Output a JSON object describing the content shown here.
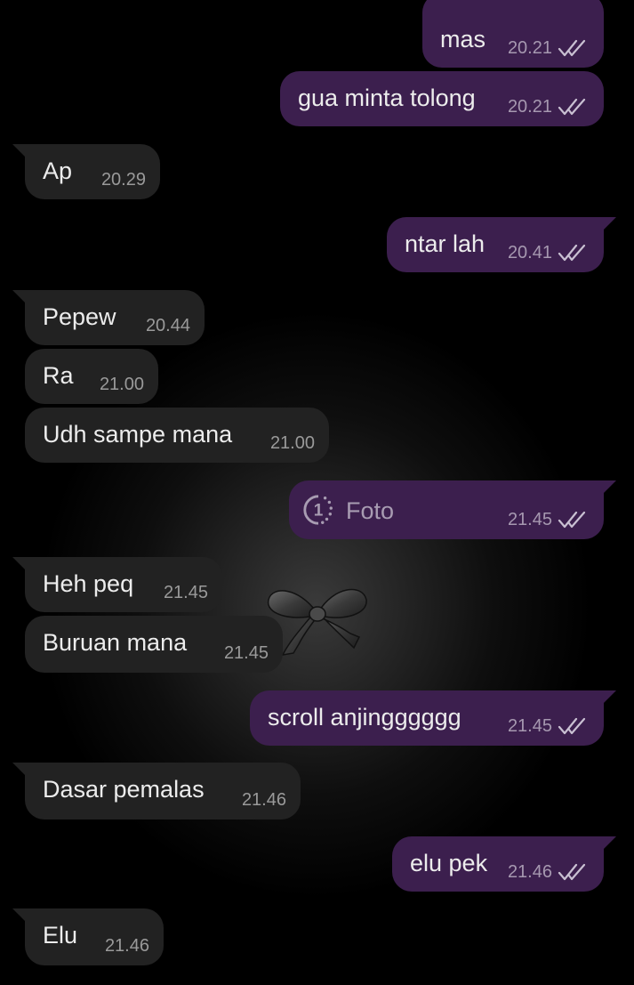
{
  "chat": {
    "messages": [
      {
        "dir": "out",
        "text": "mas",
        "time": "20.21",
        "status": "read"
      },
      {
        "dir": "out",
        "text": "gua minta tolong",
        "time": "20.21",
        "status": "read"
      },
      {
        "dir": "in",
        "text": "Ap",
        "time": "20.29"
      },
      {
        "dir": "out",
        "text": "ntar lah",
        "time": "20.41",
        "status": "read"
      },
      {
        "dir": "in",
        "text": "Pepew",
        "time": "20.44"
      },
      {
        "dir": "in",
        "text": "Ra",
        "time": "21.00"
      },
      {
        "dir": "in",
        "text": "Udh sampe mana",
        "time": "21.00"
      },
      {
        "dir": "out",
        "type": "view-once-photo",
        "icon": "view-once-icon",
        "badge": "1",
        "text": "Foto",
        "time": "21.45",
        "status": "read"
      },
      {
        "dir": "in",
        "text": "Heh peq",
        "time": "21.45"
      },
      {
        "dir": "in",
        "text": "Buruan mana",
        "time": "21.45"
      },
      {
        "dir": "out",
        "text": "scroll anjingggggg",
        "time": "21.45",
        "status": "read"
      },
      {
        "dir": "in",
        "text": "Dasar pemalas",
        "time": "21.46"
      },
      {
        "dir": "out",
        "text": "elu pek",
        "time": "21.46",
        "status": "read"
      },
      {
        "dir": "in",
        "text": "Elu",
        "time": "21.46"
      }
    ]
  },
  "theme": {
    "incoming_bubble": "#222222",
    "outgoing_bubble": "#3c1f4e",
    "text": "#ececec",
    "background": "#000000",
    "wallpaper_decoration": "ribbon-bow-icon"
  }
}
